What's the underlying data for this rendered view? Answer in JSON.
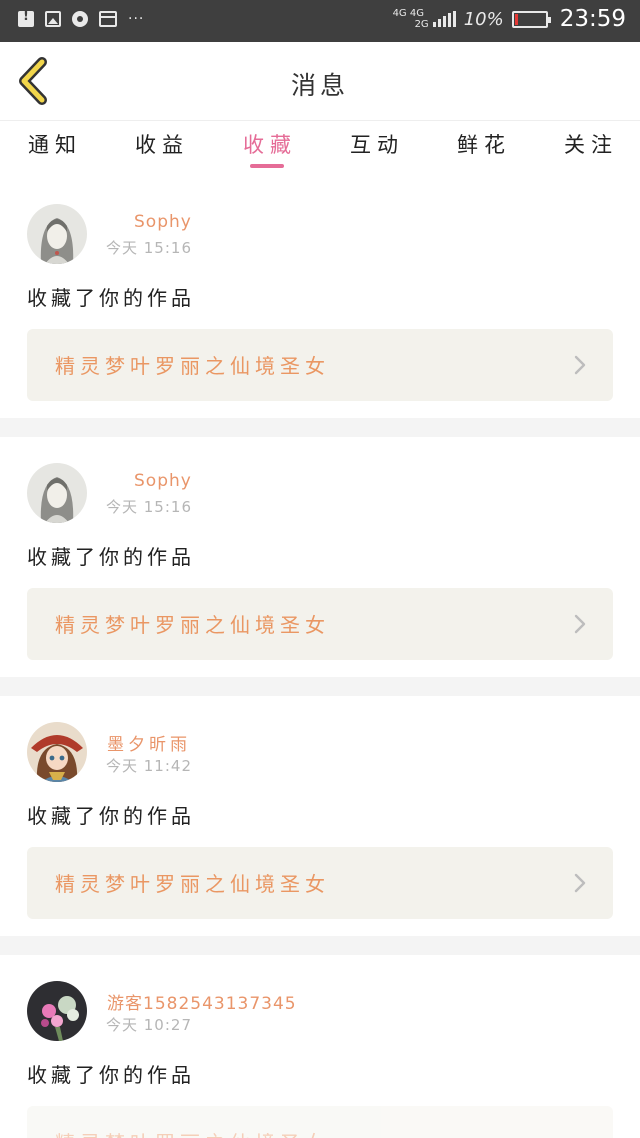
{
  "status_bar": {
    "network_top": "4G 4G",
    "network_bottom": "2G",
    "battery_percent": "10%",
    "battery_level": 0.1,
    "time": "23:59",
    "overflow": "···"
  },
  "header": {
    "title": "消息",
    "back_icon": "chevron-left-icon"
  },
  "tabs": [
    {
      "label": "通知",
      "active": false
    },
    {
      "label": "收益",
      "active": false
    },
    {
      "label": "收藏",
      "active": true
    },
    {
      "label": "互动",
      "active": false
    },
    {
      "label": "鲜花",
      "active": false
    },
    {
      "label": "关注",
      "active": false
    }
  ],
  "colors": {
    "accent": "#e56c97",
    "username": "#e9956a",
    "work_title": "#ea9763",
    "work_box_bg": "#f3f2ec"
  },
  "messages": [
    {
      "user": "Sophy",
      "time": "今天 15:16",
      "action": "收藏了你的作品",
      "work": "精灵梦叶罗丽之仙境圣女",
      "avatar": "sketch-girl-avatar"
    },
    {
      "user": "Sophy",
      "time": "今天 15:16",
      "action": "收藏了你的作品",
      "work": "精灵梦叶罗丽之仙境圣女",
      "avatar": "sketch-girl-avatar"
    },
    {
      "user": "墨夕昕雨",
      "time": "今天 11:42",
      "action": "收藏了你的作品",
      "work": "精灵梦叶罗丽之仙境圣女",
      "avatar": "anime-girl-avatar"
    },
    {
      "user": "游客1582543137345",
      "time": "今天 10:27",
      "action": "收藏了你的作品",
      "work": "精灵梦叶罗丽之仙境圣女",
      "avatar": "flowers-avatar"
    }
  ]
}
